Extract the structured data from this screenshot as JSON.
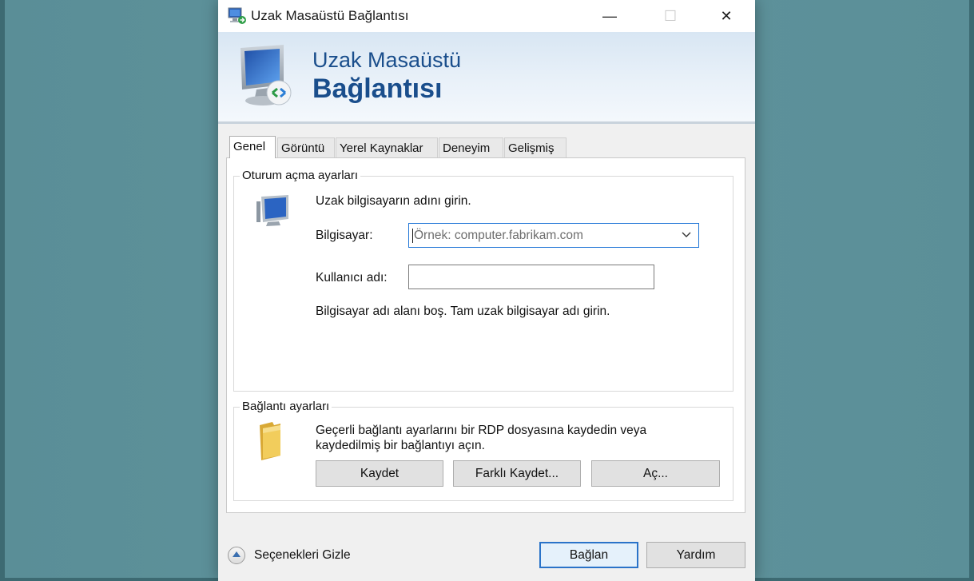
{
  "window": {
    "title": "Uzak Masaüstü Bağlantısı",
    "controls": {
      "minimize": "—",
      "maximize": "☐",
      "close": "✕"
    }
  },
  "banner": {
    "line1": "Uzak Masaüstü",
    "line2": "Bağlantısı"
  },
  "tabs": [
    {
      "label": "Genel",
      "active": true
    },
    {
      "label": "Görüntü",
      "active": false
    },
    {
      "label": "Yerel Kaynaklar",
      "active": false
    },
    {
      "label": "Deneyim",
      "active": false
    },
    {
      "label": "Gelişmiş",
      "active": false
    }
  ],
  "logon": {
    "legend": "Oturum açma ayarları",
    "instruction": "Uzak bilgisayarın adını girin.",
    "computer_label": "Bilgisayar:",
    "computer_placeholder": "Örnek: computer.fabrikam.com",
    "computer_value": "",
    "username_label": "Kullanıcı adı:",
    "username_value": "",
    "hint": "Bilgisayar adı alanı boş. Tam uzak bilgisayar adı girin."
  },
  "connection": {
    "legend": "Bağlantı ayarları",
    "description_line1": "Geçerli bağlantı ayarlarını bir RDP dosyasına kaydedin veya",
    "description_line2": "kaydedilmiş bir bağlantıyı açın.",
    "save_label": "Kaydet",
    "save_as_label": "Farklı Kaydet...",
    "open_label": "Aç..."
  },
  "footer": {
    "hide_options_label": "Seçenekleri Gizle",
    "connect_label": "Bağlan",
    "help_label": "Yardım"
  },
  "colors": {
    "background": "#5f939c",
    "accent": "#1e74d6",
    "banner_text": "#1a4e8c"
  },
  "icons": {
    "app": "remote-desktop-icon",
    "banner": "remote-desktop-monitor-icon",
    "computer": "computer-monitor-icon",
    "folder": "folder-icon",
    "chevron": "chevron-down-icon",
    "toggle": "collapse-up-icon"
  }
}
